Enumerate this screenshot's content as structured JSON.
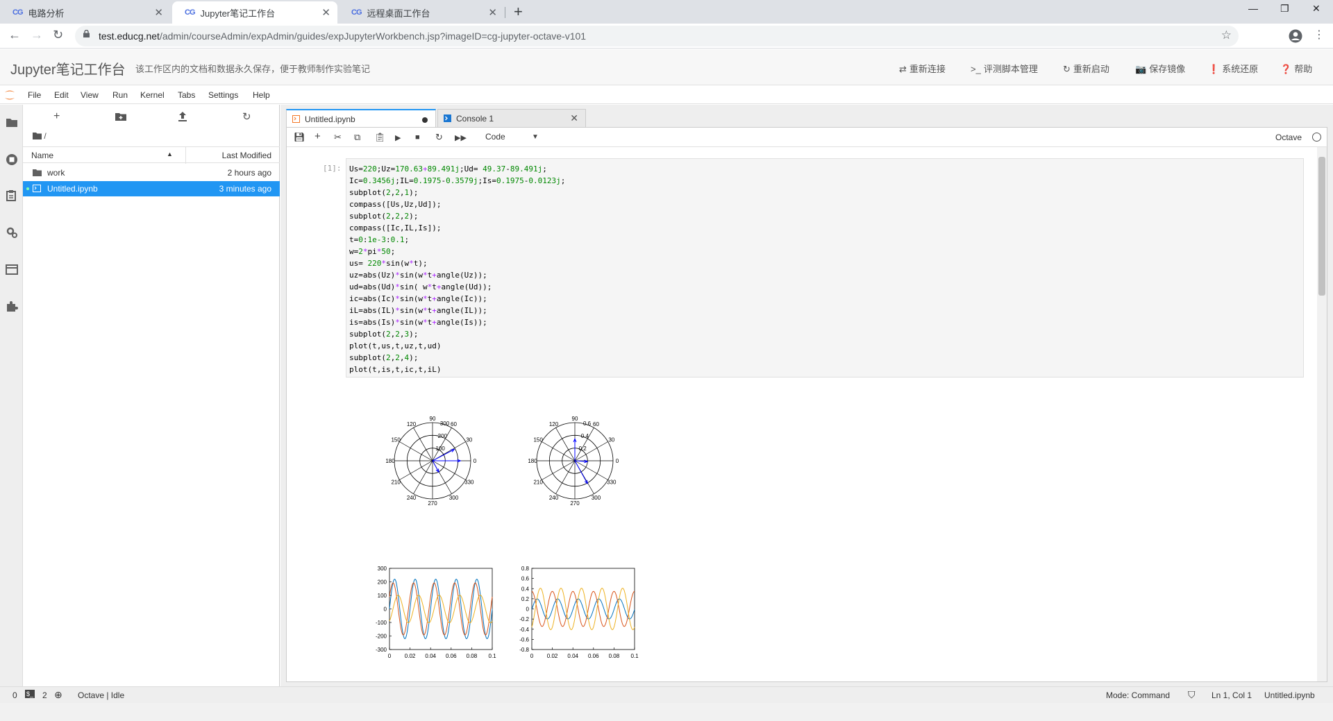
{
  "browser": {
    "tabs": [
      {
        "label": "电路分析",
        "active": false
      },
      {
        "label": "Jupyter笔记工作台",
        "active": true
      },
      {
        "label": "远程桌面工作台",
        "active": false
      }
    ],
    "favicon_text": "CG",
    "url_host": "test.educg.net",
    "url_path": "/admin/courseAdmin/expAdmin/guides/expJupyterWorkbench.jsp?imageID=cg-jupyter-octave-v101"
  },
  "header": {
    "title": "Jupyter笔记工作台",
    "subtitle": "该工作区内的文档和数据永久保存，便于教师制作实验笔记",
    "buttons": [
      "重新连接",
      "评测脚本管理",
      "重新启动",
      "保存镜像",
      "系统还原",
      "帮助"
    ]
  },
  "menu": [
    "File",
    "Edit",
    "View",
    "Run",
    "Kernel",
    "Tabs",
    "Settings",
    "Help"
  ],
  "filebrowser": {
    "breadcrumb": "/",
    "col_name": "Name",
    "col_modified": "Last Modified",
    "rows": [
      {
        "name": "work",
        "modified": "2 hours ago",
        "type": "folder"
      },
      {
        "name": "Untitled.ipynb",
        "modified": "3 minutes ago",
        "type": "notebook"
      }
    ]
  },
  "doc_tabs": [
    {
      "label": "Untitled.ipynb",
      "active": true
    },
    {
      "label": "Console 1",
      "active": false
    }
  ],
  "notebook": {
    "cell_type": "Code",
    "kernel": "Octave",
    "prompt": "[1]:",
    "code_lines": [
      "Us=220;Uz=170.63+89.491j;Ud= 49.37-89.491j;",
      "Ic=0.3456j;IL=0.1975-0.3579j;Is=0.1975-0.0123j;",
      "subplot(2,2,1);",
      "compass([Us,Uz,Ud]);",
      "subplot(2,2,2);",
      "compass([Ic,IL,Is]);",
      "t=0:1e-3:0.1;",
      "w=2*pi*50;",
      "us= 220*sin(w*t);",
      "uz=abs(Uz)*sin(w*t+angle(Uz));",
      "ud=abs(Ud)*sin( w*t+angle(Ud));",
      "ic=abs(Ic)*sin(w*t+angle(Ic));",
      "iL=abs(IL)*sin(w*t+angle(IL));",
      "is=abs(Is)*sin(w*t+angle(Is));",
      "subplot(2,2,3);",
      "plot(t,us,t,uz,t,ud)",
      "subplot(2,2,4);",
      "plot(t,is,t,ic,t,iL)"
    ]
  },
  "status": {
    "left0": "0",
    "left2": "2",
    "kernel_status": "Octave | Idle",
    "mode": "Mode: Command",
    "position": "Ln 1, Col 1",
    "file": "Untitled.ipynb"
  },
  "chart_data": [
    {
      "type": "compass",
      "angle_labels": [
        "0",
        "30",
        "60",
        "90",
        "120",
        "150",
        "180",
        "210",
        "240",
        "270",
        "300",
        "330"
      ],
      "radial_labels": [
        "100",
        "200",
        "300"
      ],
      "vectors": [
        {
          "re": 220,
          "im": 0
        },
        {
          "re": 170.63,
          "im": 89.491
        },
        {
          "re": 49.37,
          "im": -89.491
        }
      ]
    },
    {
      "type": "compass",
      "angle_labels": [
        "0",
        "30",
        "60",
        "90",
        "120",
        "150",
        "180",
        "210",
        "240",
        "270",
        "300",
        "330"
      ],
      "radial_labels": [
        "0.2",
        "0.4",
        "0.6"
      ],
      "vectors": [
        {
          "re": 0,
          "im": 0.3456
        },
        {
          "re": 0.1975,
          "im": -0.3579
        },
        {
          "re": 0.1975,
          "im": -0.0123
        }
      ]
    },
    {
      "type": "line",
      "xlim": [
        0,
        0.1
      ],
      "ylim": [
        -300,
        300
      ],
      "xticks": [
        "0",
        "0.02",
        "0.04",
        "0.06",
        "0.08",
        "0.1"
      ],
      "yticks": [
        "300",
        "200",
        "100",
        "0",
        "-100",
        "-200",
        "-300"
      ],
      "series": [
        {
          "amp": 220,
          "phase_deg": 0,
          "color": "#0072bd"
        },
        {
          "amp": 192.67,
          "phase_deg": 27.67,
          "color": "#d95319"
        },
        {
          "amp": 102.2,
          "phase_deg": -61.1,
          "color": "#edb120"
        }
      ]
    },
    {
      "type": "line",
      "xlim": [
        0,
        0.1
      ],
      "ylim": [
        -0.8,
        0.8
      ],
      "xticks": [
        "0",
        "0.02",
        "0.04",
        "0.06",
        "0.08",
        "0.1"
      ],
      "yticks": [
        "0.8",
        "0.6",
        "0.4",
        "0.2",
        "0",
        "-0.2",
        "-0.4",
        "-0.6",
        "-0.8"
      ],
      "series": [
        {
          "amp": 0.1979,
          "phase_deg": -3.56,
          "color": "#0072bd"
        },
        {
          "amp": 0.3456,
          "phase_deg": 90,
          "color": "#d95319"
        },
        {
          "amp": 0.4088,
          "phase_deg": -61.1,
          "color": "#edb120"
        }
      ]
    }
  ]
}
